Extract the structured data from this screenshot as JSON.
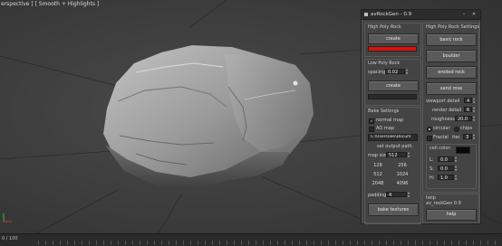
{
  "viewport": {
    "label": "erspective ] [ Smooth + Highlights ]"
  },
  "timeline": {
    "counter": "0 / 100"
  },
  "window": {
    "title": "avRockGen - 0.9",
    "min_glyph": "–",
    "close_glyph": "✕"
  },
  "high_poly_rock": {
    "label": "High Poly Rock",
    "create_label": "create",
    "status_color": "#e01010"
  },
  "low_poly_rock": {
    "label": "Low Poly Rock",
    "spacing_label": "spacing",
    "spacing_value": "0.02",
    "create_label": "create"
  },
  "bake": {
    "label": "Bake Settings",
    "normal_map_label": "normal map",
    "normal_map_checked": true,
    "ao_map_label": "AO map",
    "ao_map_checked": false,
    "path_value": "C:\\Users\\ale\\Docum",
    "set_output_path_label": "set output path",
    "map_size_label": "map size",
    "map_size_value": "512",
    "sizes": [
      "128",
      "256",
      "512",
      "1024",
      "2048",
      "4096"
    ],
    "padding_label": "padding",
    "padding_value": "4",
    "bake_button_label": "bake textures"
  },
  "high_poly_settings": {
    "label": "High Poly Rock Settings",
    "buttons": [
      "basic rock",
      "boulder",
      "eroded rock",
      "sand rose"
    ],
    "viewport_detail_label": "viewport detail",
    "viewport_detail_value": "4",
    "render_detail_label": "render detail",
    "render_detail_value": "6",
    "roughness_label": "roughness",
    "roughness_value": "20.0",
    "circular_label": "circular",
    "circular_selected": true,
    "chips_label": "chips",
    "chips_selected": false,
    "fractal_label": "Fractal",
    "fractal_checked": false,
    "iter_label": "iter.",
    "iter_value": "3"
  },
  "cell_color": {
    "label": "cell color:",
    "swatch_color": "#080808",
    "l_label": "L:",
    "l_value": "0.0",
    "s_label": "S:",
    "s_value": "0.0",
    "h_label": "H:",
    "h_value": "1.0"
  },
  "help": {
    "label": "help",
    "version_text": "av_rockGen 0.9",
    "button_label": "help"
  }
}
